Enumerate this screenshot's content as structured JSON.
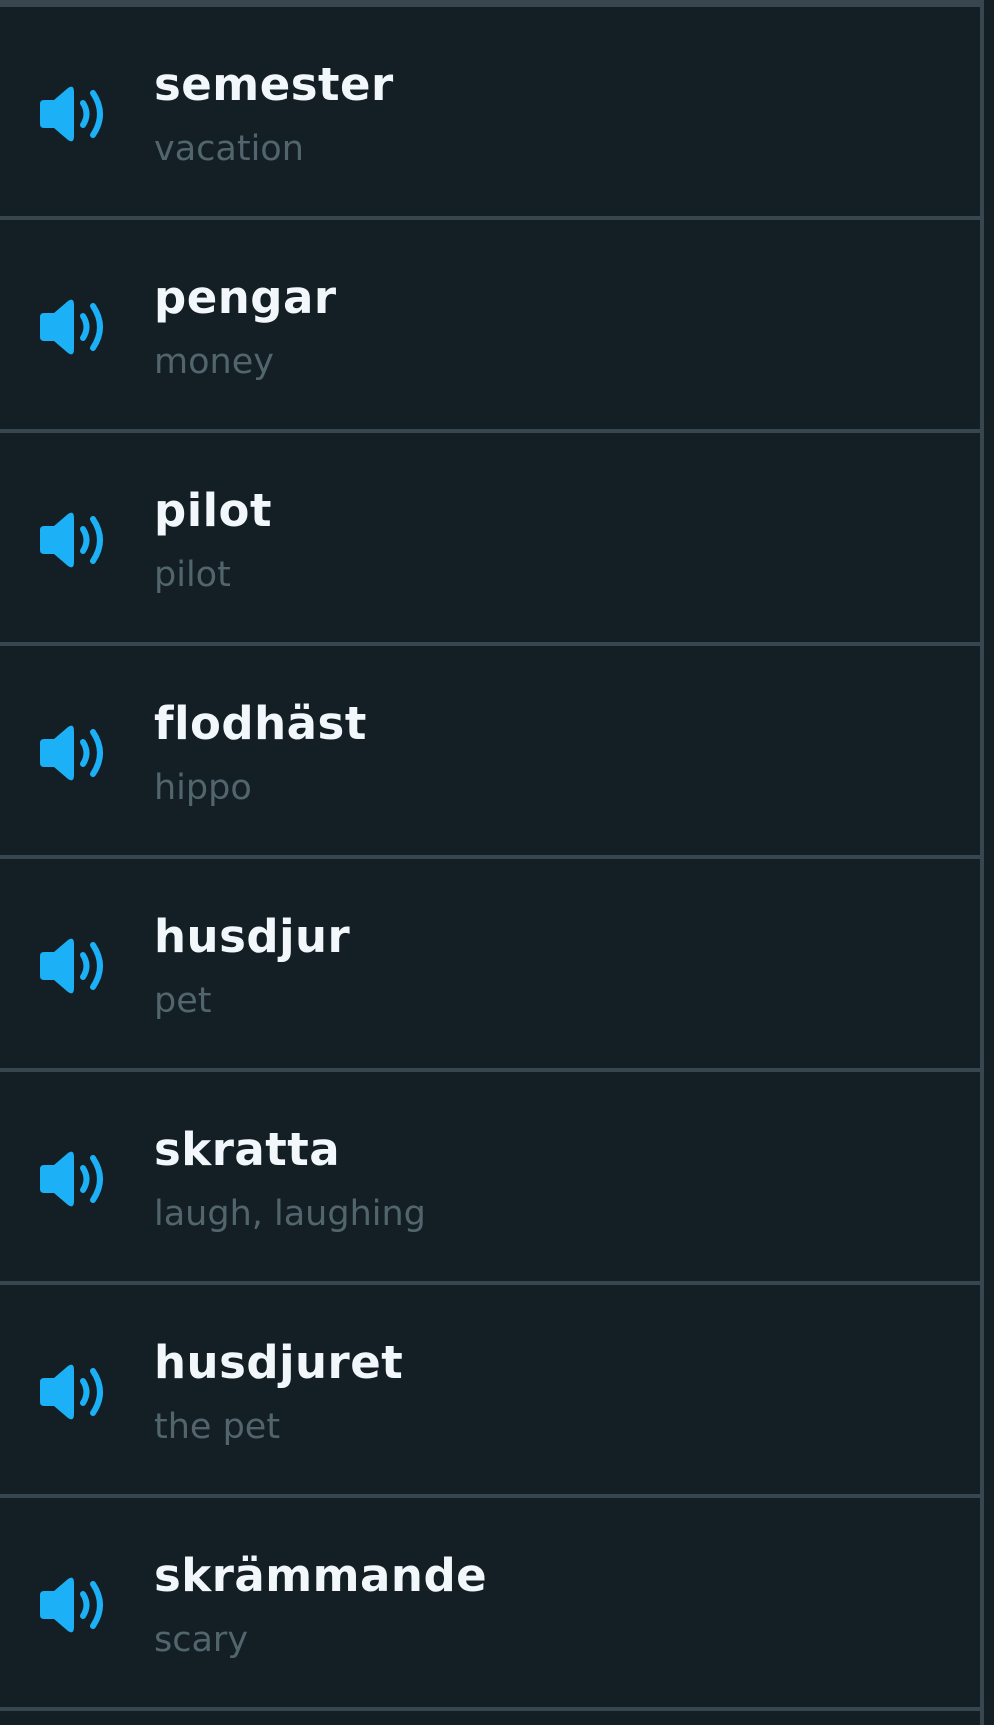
{
  "icon_color": "#1cb0f6",
  "words": [
    {
      "word": "semester",
      "translation": "vacation",
      "icon": "speaker-icon"
    },
    {
      "word": "pengar",
      "translation": "money",
      "icon": "speaker-icon"
    },
    {
      "word": "pilot",
      "translation": "pilot",
      "icon": "speaker-icon"
    },
    {
      "word": "flodhäst",
      "translation": "hippo",
      "icon": "speaker-icon"
    },
    {
      "word": "husdjur",
      "translation": "pet",
      "icon": "speaker-icon"
    },
    {
      "word": "skratta",
      "translation": "laugh, laughing",
      "icon": "speaker-icon"
    },
    {
      "word": "husdjuret",
      "translation": "the pet",
      "icon": "speaker-icon"
    },
    {
      "word": "skrämmande",
      "translation": "scary",
      "icon": "speaker-icon"
    }
  ]
}
